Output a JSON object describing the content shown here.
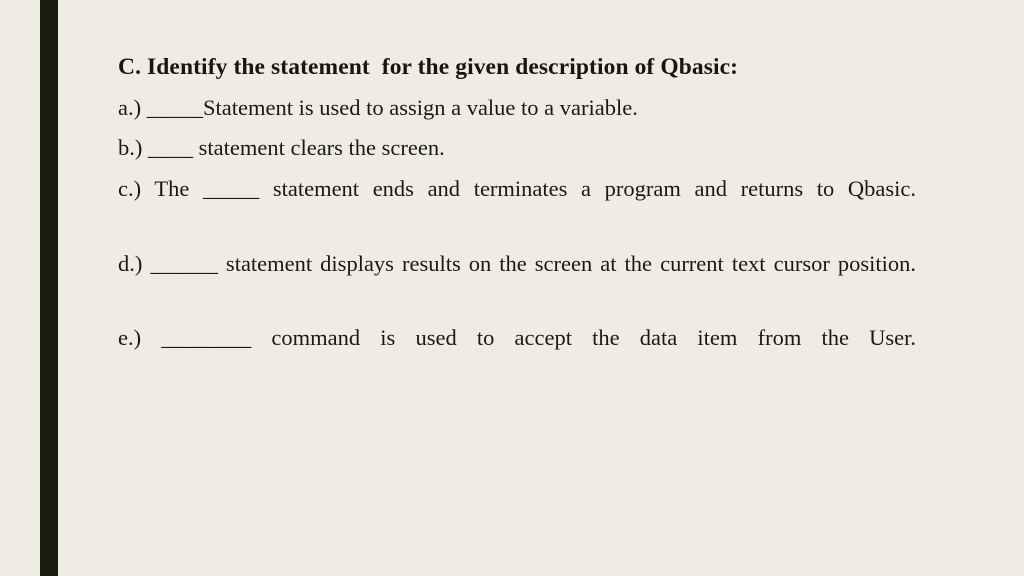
{
  "slide": {
    "background_color": "#EFEDE3",
    "text_color": "#1A1A12",
    "accent_bar_color": "#1B1D0E",
    "title": "C. Identify the statement  for the given description of Qbasic:",
    "items": [
      {
        "label": "a.)",
        "text": "a.) _____Statement is used to assign a value to a variable."
      },
      {
        "label": "b.)",
        "text": "b.) ____ statement clears the screen."
      },
      {
        "label": "c.)",
        "text": "c.) The _____ statement ends and terminates a program and returns to Qbasic."
      },
      {
        "label": "d.)",
        "text": "d.) ______ statement displays results on the screen at the current text cursor position."
      },
      {
        "label": "e.)",
        "text": "e.) ________ command is used to accept the data item from the User."
      }
    ]
  }
}
